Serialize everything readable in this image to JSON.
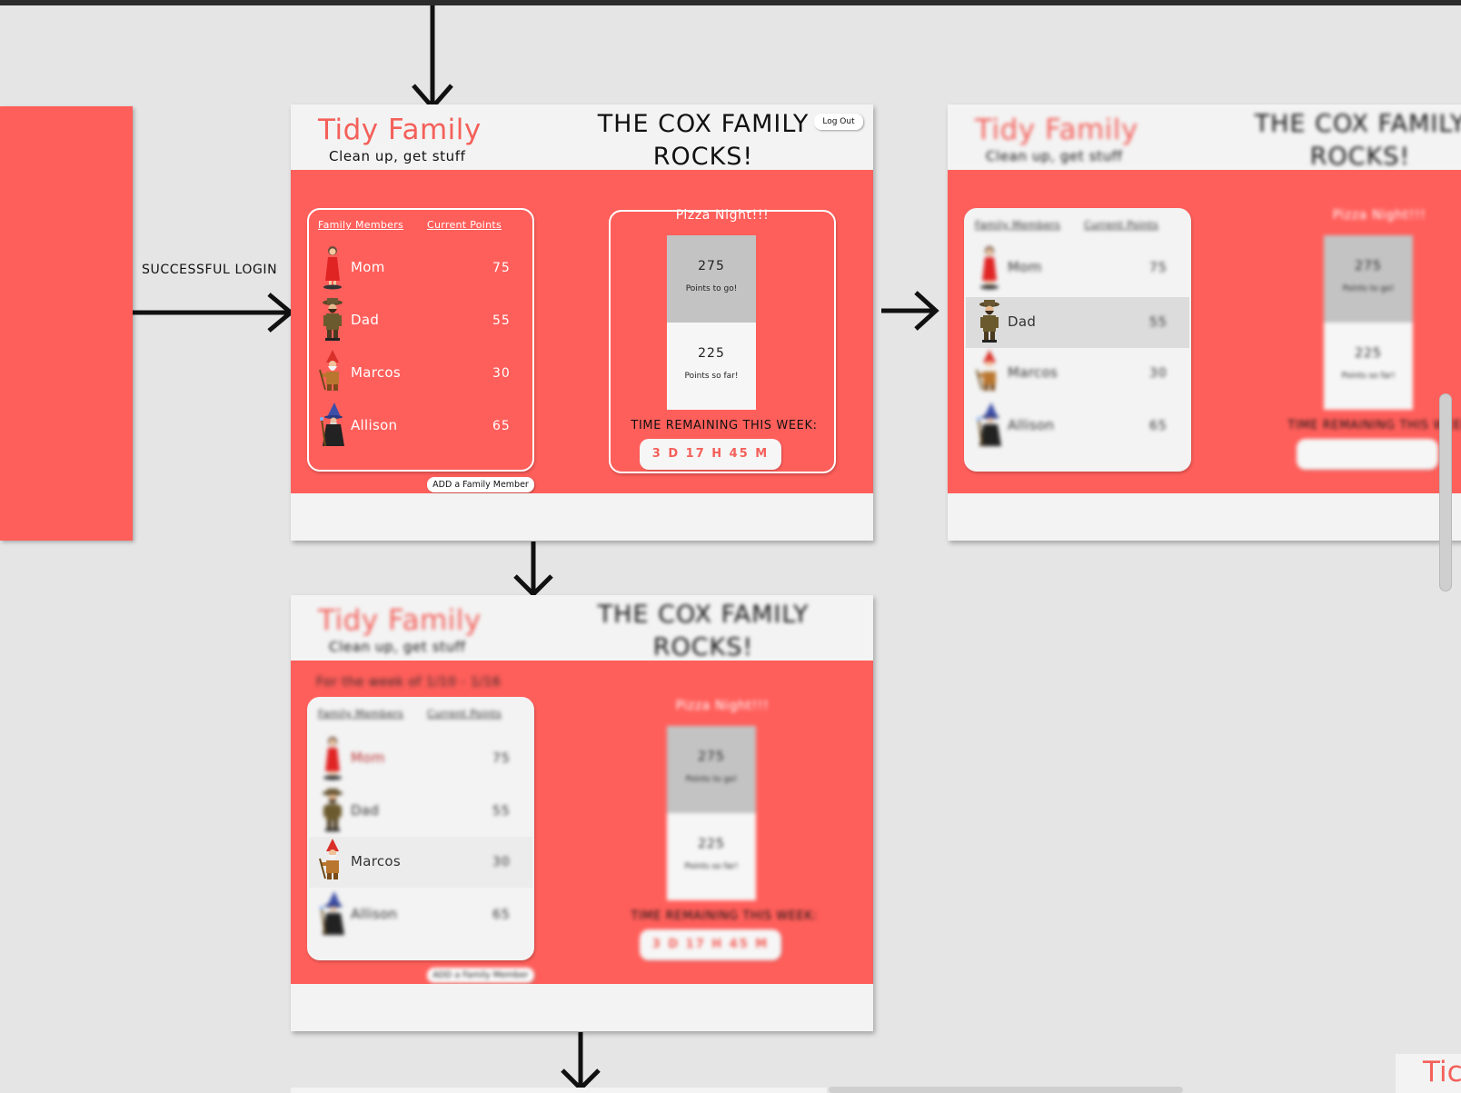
{
  "flow": {
    "login_label": "SUCCESSFUL LOGIN"
  },
  "app": {
    "logo": "Tidy Family",
    "tagline": "Clean up, get stuff",
    "family_title": "THE COX FAMILY ROCKS!",
    "logout_label": "Log Out",
    "members_header": "Family Members",
    "points_header": "Current Points",
    "members": [
      {
        "name": "Mom",
        "points": "75",
        "avatar": "woman-red-dress-avatar"
      },
      {
        "name": "Dad",
        "points": "55",
        "avatar": "explorer-avatar"
      },
      {
        "name": "Marcos",
        "points": "30",
        "avatar": "gnome-avatar"
      },
      {
        "name": "Allison",
        "points": "65",
        "avatar": "wizard-avatar"
      }
    ],
    "add_member_label": "ADD a Family Member",
    "goal": {
      "title": "Pizza Night!!!",
      "points_to_go": "275",
      "points_to_go_caption": "Points to go!",
      "points_so_far": "225",
      "points_so_far_caption": "Points so far!",
      "time_label": "TIME REMAINING THIS WEEK:",
      "timer": "3 D  17 H  45 M"
    },
    "week_label": "For the week of 1/10 - 1/16"
  },
  "colors": {
    "brand": "#ff5f5b",
    "panel": "#f3f3f3",
    "canvas": "#e5e5e5"
  }
}
